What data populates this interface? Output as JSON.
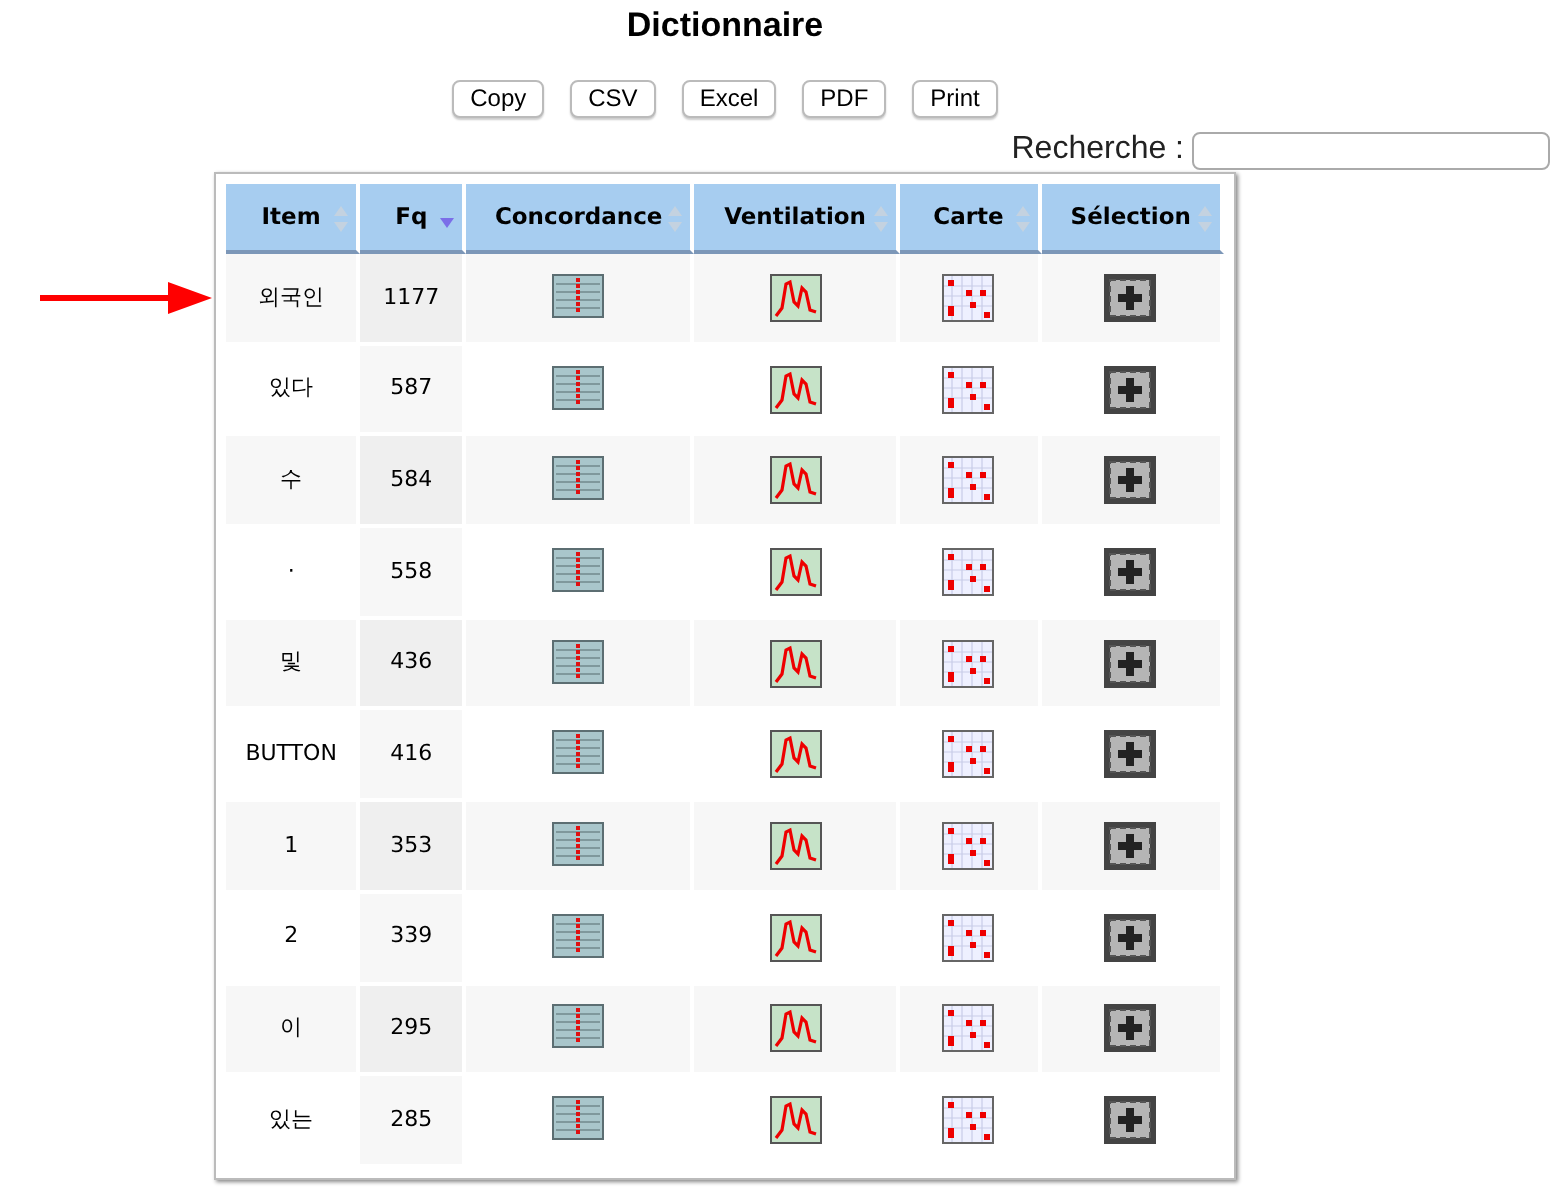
{
  "title": "Dictionnaire",
  "buttons": [
    "Copy",
    "CSV",
    "Excel",
    "PDF",
    "Print"
  ],
  "search": {
    "label": "Recherche :"
  },
  "table": {
    "columns": [
      {
        "label": "Item",
        "sorted": false
      },
      {
        "label": "Fq",
        "sorted": true
      },
      {
        "label": "Concordance",
        "sorted": false
      },
      {
        "label": "Ventilation",
        "sorted": false
      },
      {
        "label": "Carte",
        "sorted": false
      },
      {
        "label": "Sélection",
        "sorted": false
      }
    ],
    "rows": [
      {
        "item": "외국인",
        "fq": "1177",
        "marked": true
      },
      {
        "item": "있다",
        "fq": "587",
        "marked": false
      },
      {
        "item": "수",
        "fq": "584",
        "marked": false
      },
      {
        "item": "·",
        "fq": "558",
        "marked": false
      },
      {
        "item": "및",
        "fq": "436",
        "marked": false
      },
      {
        "item": "BUTTON",
        "fq": "416",
        "marked": false
      },
      {
        "item": "1",
        "fq": "353",
        "marked": false
      },
      {
        "item": "2",
        "fq": "339",
        "marked": false
      },
      {
        "item": "이",
        "fq": "295",
        "marked": false
      },
      {
        "item": "있는",
        "fq": "285",
        "marked": false
      }
    ]
  }
}
